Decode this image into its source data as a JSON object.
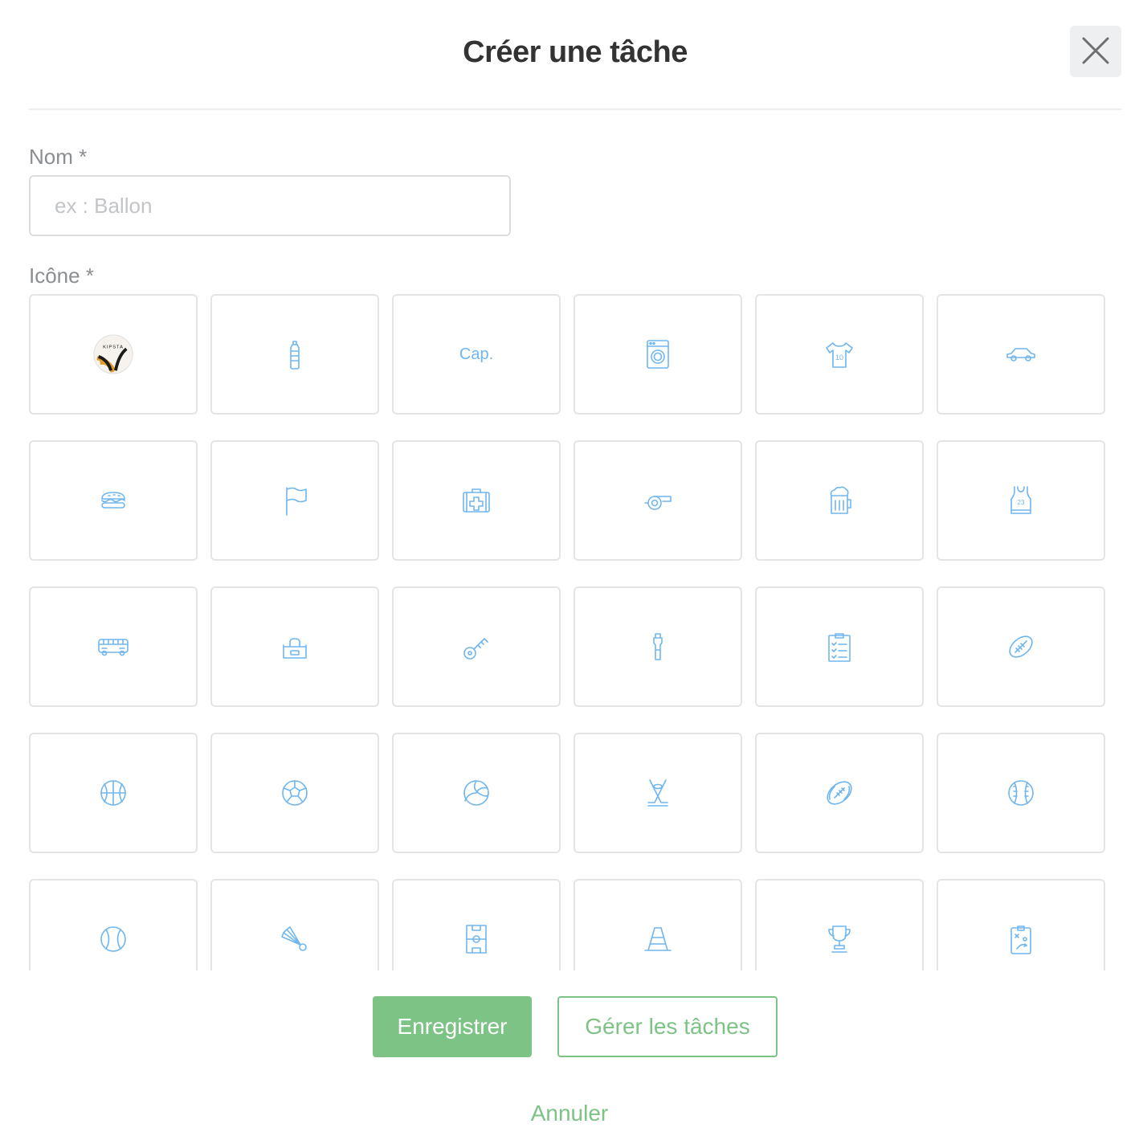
{
  "modal": {
    "title": "Créer une tâche",
    "close_icon": "close-icon"
  },
  "form": {
    "name_label": "Nom *",
    "name_placeholder": "ex : Ballon",
    "name_value": "",
    "icon_label": "Icône *"
  },
  "icons": [
    {
      "name": "kipsta-ball",
      "text": "KIPSTA"
    },
    {
      "name": "water-bottle"
    },
    {
      "name": "captain-armband",
      "text": "Cap."
    },
    {
      "name": "washing-machine"
    },
    {
      "name": "jersey-10",
      "text": "10"
    },
    {
      "name": "car"
    },
    {
      "name": "sandwich"
    },
    {
      "name": "flag"
    },
    {
      "name": "first-aid-kit"
    },
    {
      "name": "whistle"
    },
    {
      "name": "beer-mug"
    },
    {
      "name": "tank-top-23",
      "text": "23"
    },
    {
      "name": "bus"
    },
    {
      "name": "sports-bag"
    },
    {
      "name": "key"
    },
    {
      "name": "sports-bottle"
    },
    {
      "name": "clipboard-checklist"
    },
    {
      "name": "rugby-ball"
    },
    {
      "name": "basketball"
    },
    {
      "name": "soccer-ball"
    },
    {
      "name": "volleyball"
    },
    {
      "name": "hockey-sticks"
    },
    {
      "name": "american-football"
    },
    {
      "name": "baseball"
    },
    {
      "name": "tennis-ball"
    },
    {
      "name": "shuttlecock"
    },
    {
      "name": "field"
    },
    {
      "name": "cone"
    },
    {
      "name": "trophy"
    },
    {
      "name": "tactics-board"
    }
  ],
  "actions": {
    "save_label": "Enregistrer",
    "manage_label": "Gérer les tâches",
    "cancel_label": "Annuler"
  },
  "colors": {
    "accent": "#7cc385",
    "icon_blue": "#6fb6ee",
    "border": "#e4e4e4",
    "title": "#333333"
  }
}
